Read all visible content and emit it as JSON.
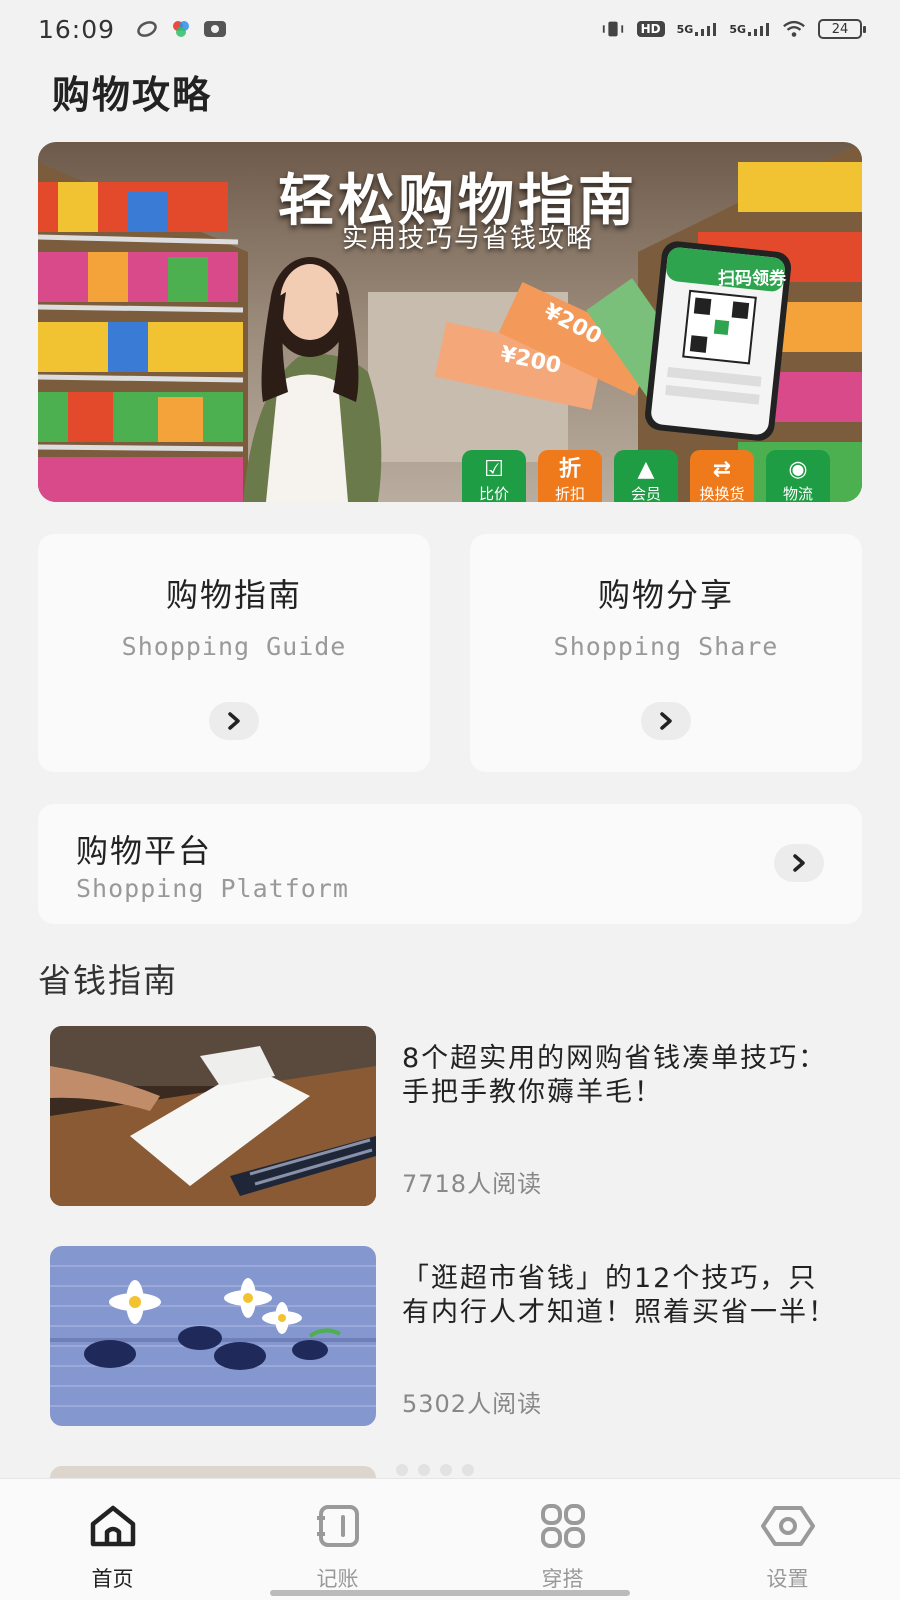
{
  "status_bar": {
    "time": "16:09",
    "network_1": "5G",
    "network_2": "5G",
    "hd_label": "HD",
    "battery": "24"
  },
  "page": {
    "title": "购物攻略"
  },
  "banner": {
    "title": "轻松购物指南",
    "subtitle": "实用技巧与省钱攻略",
    "phone_label": "扫码领券",
    "coupon_1": "¥200",
    "coupon_2": "¥200",
    "tiles": [
      {
        "icon": "☑",
        "label": "比价",
        "color": "#1e9d45"
      },
      {
        "icon": "折",
        "label": "折扣",
        "color": "#ef7a1c"
      },
      {
        "icon": "▲",
        "label": "会员",
        "color": "#1e9d45"
      },
      {
        "icon": "⇄",
        "label": "换换货",
        "color": "#ef7a1c"
      },
      {
        "icon": "◉",
        "label": "物流",
        "color": "#1e9d45"
      }
    ]
  },
  "cards": {
    "guide": {
      "title": "购物指南",
      "subtitle": "Shopping Guide"
    },
    "share": {
      "title": "购物分享",
      "subtitle": "Shopping Share"
    },
    "platform": {
      "title": "购物平台",
      "subtitle": "Shopping Platform"
    }
  },
  "section": {
    "title": "省钱指南"
  },
  "articles": [
    {
      "title": "8个超实用的网购省钱凑单技巧：手把手教你薅羊毛！",
      "reads": "7718人阅读"
    },
    {
      "title": "「逛超市省钱」的12个技巧，只有内行人才知道！照着买省一半！",
      "reads": "5302人阅读"
    }
  ],
  "tab_bar": {
    "tabs": [
      {
        "label": "首页",
        "icon": "home-icon",
        "active": true
      },
      {
        "label": "记账",
        "icon": "notebook-icon",
        "active": false
      },
      {
        "label": "穿搭",
        "icon": "grid-icon",
        "active": false
      },
      {
        "label": "设置",
        "icon": "settings-icon",
        "active": false
      }
    ]
  }
}
